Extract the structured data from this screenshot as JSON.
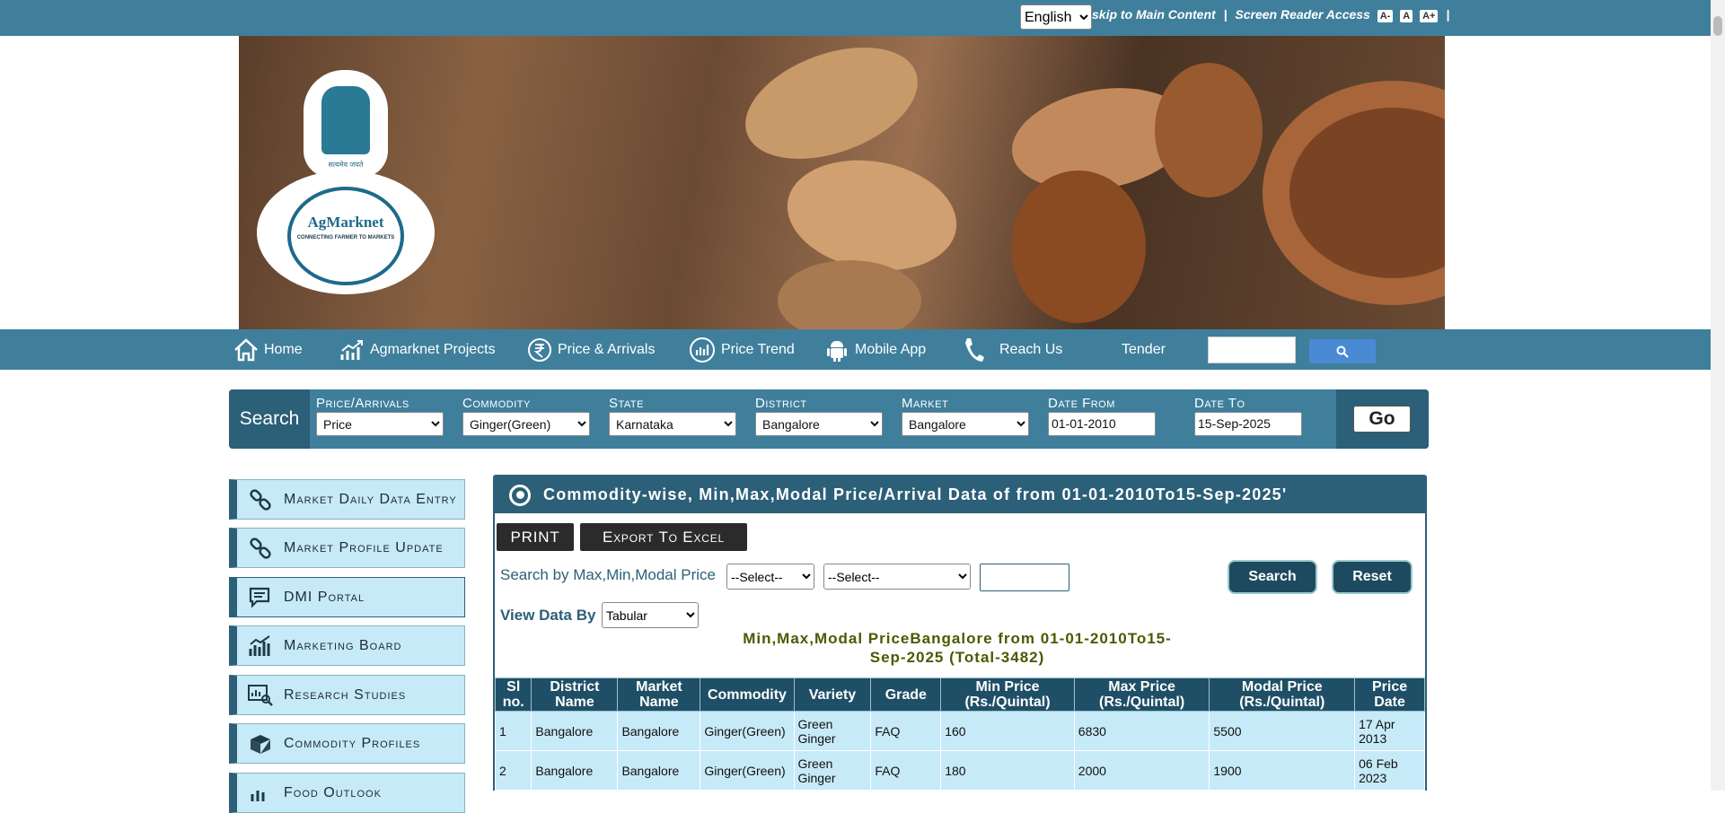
{
  "topbar": {
    "language": "English",
    "skip_link": "skip to Main Content",
    "reader_link": "Screen Reader Access",
    "font_small": "A-",
    "font_normal": "A",
    "font_large": "A+",
    "separator": "|"
  },
  "logo": {
    "name": "AgMarknet",
    "tagline": "CONNECTING FARMER TO MARKETS",
    "motto": "सत्यमेव जयते"
  },
  "nav": {
    "items": [
      {
        "label": "Home",
        "icon": "home-icon"
      },
      {
        "label": "Agmarknet Projects",
        "icon": "chart-icon"
      },
      {
        "label": "Price & Arrivals",
        "icon": "rupee-icon"
      },
      {
        "label": "Price Trend",
        "icon": "trend-icon"
      },
      {
        "label": "Mobile App",
        "icon": "android-icon"
      },
      {
        "label": "Reach Us",
        "icon": "phone-icon"
      },
      {
        "label": "Tender",
        "icon": ""
      }
    ]
  },
  "search": {
    "label": "Search",
    "fields": [
      {
        "label": "Price/Arrivals",
        "value": "Price"
      },
      {
        "label": "Commodity",
        "value": "Ginger(Green)"
      },
      {
        "label": "State",
        "value": "Karnataka"
      },
      {
        "label": "District",
        "value": "Bangalore"
      },
      {
        "label": "Market",
        "value": "Bangalore"
      }
    ],
    "date_from_label": "Date From",
    "date_from": "01-01-2010",
    "date_to_label": "Date To",
    "date_to": "15-Sep-2025",
    "go": "Go"
  },
  "sidebar": {
    "items": [
      {
        "label": "Market Daily Data Entry",
        "icon": "link-icon"
      },
      {
        "label": "Market Profile Update",
        "icon": "link-icon"
      },
      {
        "label": "DMI Portal",
        "icon": "chat-icon"
      },
      {
        "label": "Marketing Board",
        "icon": "board-icon"
      },
      {
        "label": "Research Studies",
        "icon": "research-icon"
      },
      {
        "label": "Commodity Profiles",
        "icon": "box-icon"
      },
      {
        "label": "Food Outlook",
        "icon": "outlook-icon"
      }
    ]
  },
  "main": {
    "heading": "Commodity-wise, Min,Max,Modal Price/Arrival Data of from 01-01-2010To15-Sep-2025'",
    "print": "PRINT",
    "export": "Export To Excel",
    "search_by_label": "Search by Max,Min,Modal Price",
    "select1": "--Select--",
    "select2": "--Select--",
    "search_btn": "Search",
    "reset_btn": "Reset",
    "view_by_label": "View Data By",
    "view_by_value": "Tabular",
    "result_title_line1": "Min,Max,Modal PriceBangalore from 01-01-2010To15-",
    "result_title_line2": "Sep-2025 (Total-3482)"
  },
  "table": {
    "headers": [
      "Sl no.",
      "District Name",
      "Market Name",
      "Commodity",
      "Variety",
      "Grade",
      "Min Price (Rs./Quintal)",
      "Max Price (Rs./Quintal)",
      "Modal Price (Rs./Quintal)",
      "Price Date"
    ],
    "rows": [
      [
        "1",
        "Bangalore",
        "Bangalore",
        "Ginger(Green)",
        "Green Ginger",
        "FAQ",
        "160",
        "6830",
        "5500",
        "17 Apr 2013"
      ],
      [
        "2",
        "Bangalore",
        "Bangalore",
        "Ginger(Green)",
        "Green Ginger",
        "FAQ",
        "180",
        "2000",
        "1900",
        "06 Feb 2023"
      ]
    ]
  }
}
